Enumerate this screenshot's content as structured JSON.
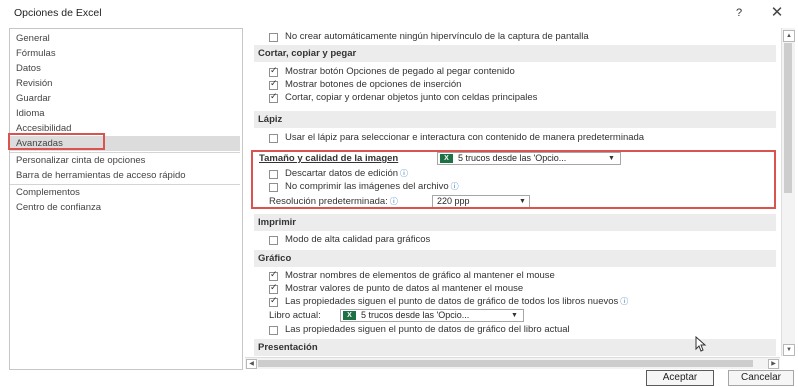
{
  "window": {
    "title": "Opciones de Excel",
    "help": "?",
    "close": "✕"
  },
  "nav": {
    "items": [
      "General",
      "Fórmulas",
      "Datos",
      "Revisión",
      "Guardar",
      "Idioma",
      "Accesibilidad",
      "Avanzadas",
      "Personalizar cinta de opciones",
      "Barra de herramientas de acceso rápido",
      "Complementos",
      "Centro de confianza"
    ],
    "selected": "Avanzadas"
  },
  "content": {
    "top_item": "No crear automáticamente ningún hipervínculo de la captura de pantalla",
    "cut_copy": {
      "header": "Cortar, copiar y pegar",
      "items": [
        "Mostrar botón Opciones de pegado al pegar contenido",
        "Mostrar botones de opciones de inserción",
        "Cortar, copiar y ordenar objetos junto con celdas principales"
      ]
    },
    "pen": {
      "header": "Lápiz",
      "item": "Usar el lápiz para seleccionar e interactura con contenido de manera predeterminada"
    },
    "image": {
      "header": "Tamaño y calidad de la imagen",
      "file": "5 trucos desde las 'Opcio...",
      "discard": "Descartar datos de edición",
      "no_compress": "No comprimir las imágenes del archivo",
      "resolution_label": "Resolución predeterminada:",
      "resolution_value": "220 ppp"
    },
    "print": {
      "header": "Imprimir",
      "item": "Modo de alta calidad para gráficos"
    },
    "chart": {
      "header": "Gráfico",
      "items": [
        "Mostrar nombres de elementos de gráfico al mantener el mouse",
        "Mostrar valores de punto de datos al mantener el mouse",
        "Las propiedades siguen el punto de datos de gráfico de todos los libros nuevos"
      ],
      "book_label": "Libro actual:",
      "book_value": "5 trucos desde las 'Opcio...",
      "book_item": "Las propiedades siguen el punto de datos de gráfico del libro actual"
    },
    "presentation": {
      "header": "Presentación"
    }
  },
  "footer": {
    "ok": "Aceptar",
    "cancel": "Cancelar"
  },
  "colors": {
    "highlight": "#d9534f",
    "excel_green": "#1e7145",
    "info_blue": "#2f6fb8"
  }
}
